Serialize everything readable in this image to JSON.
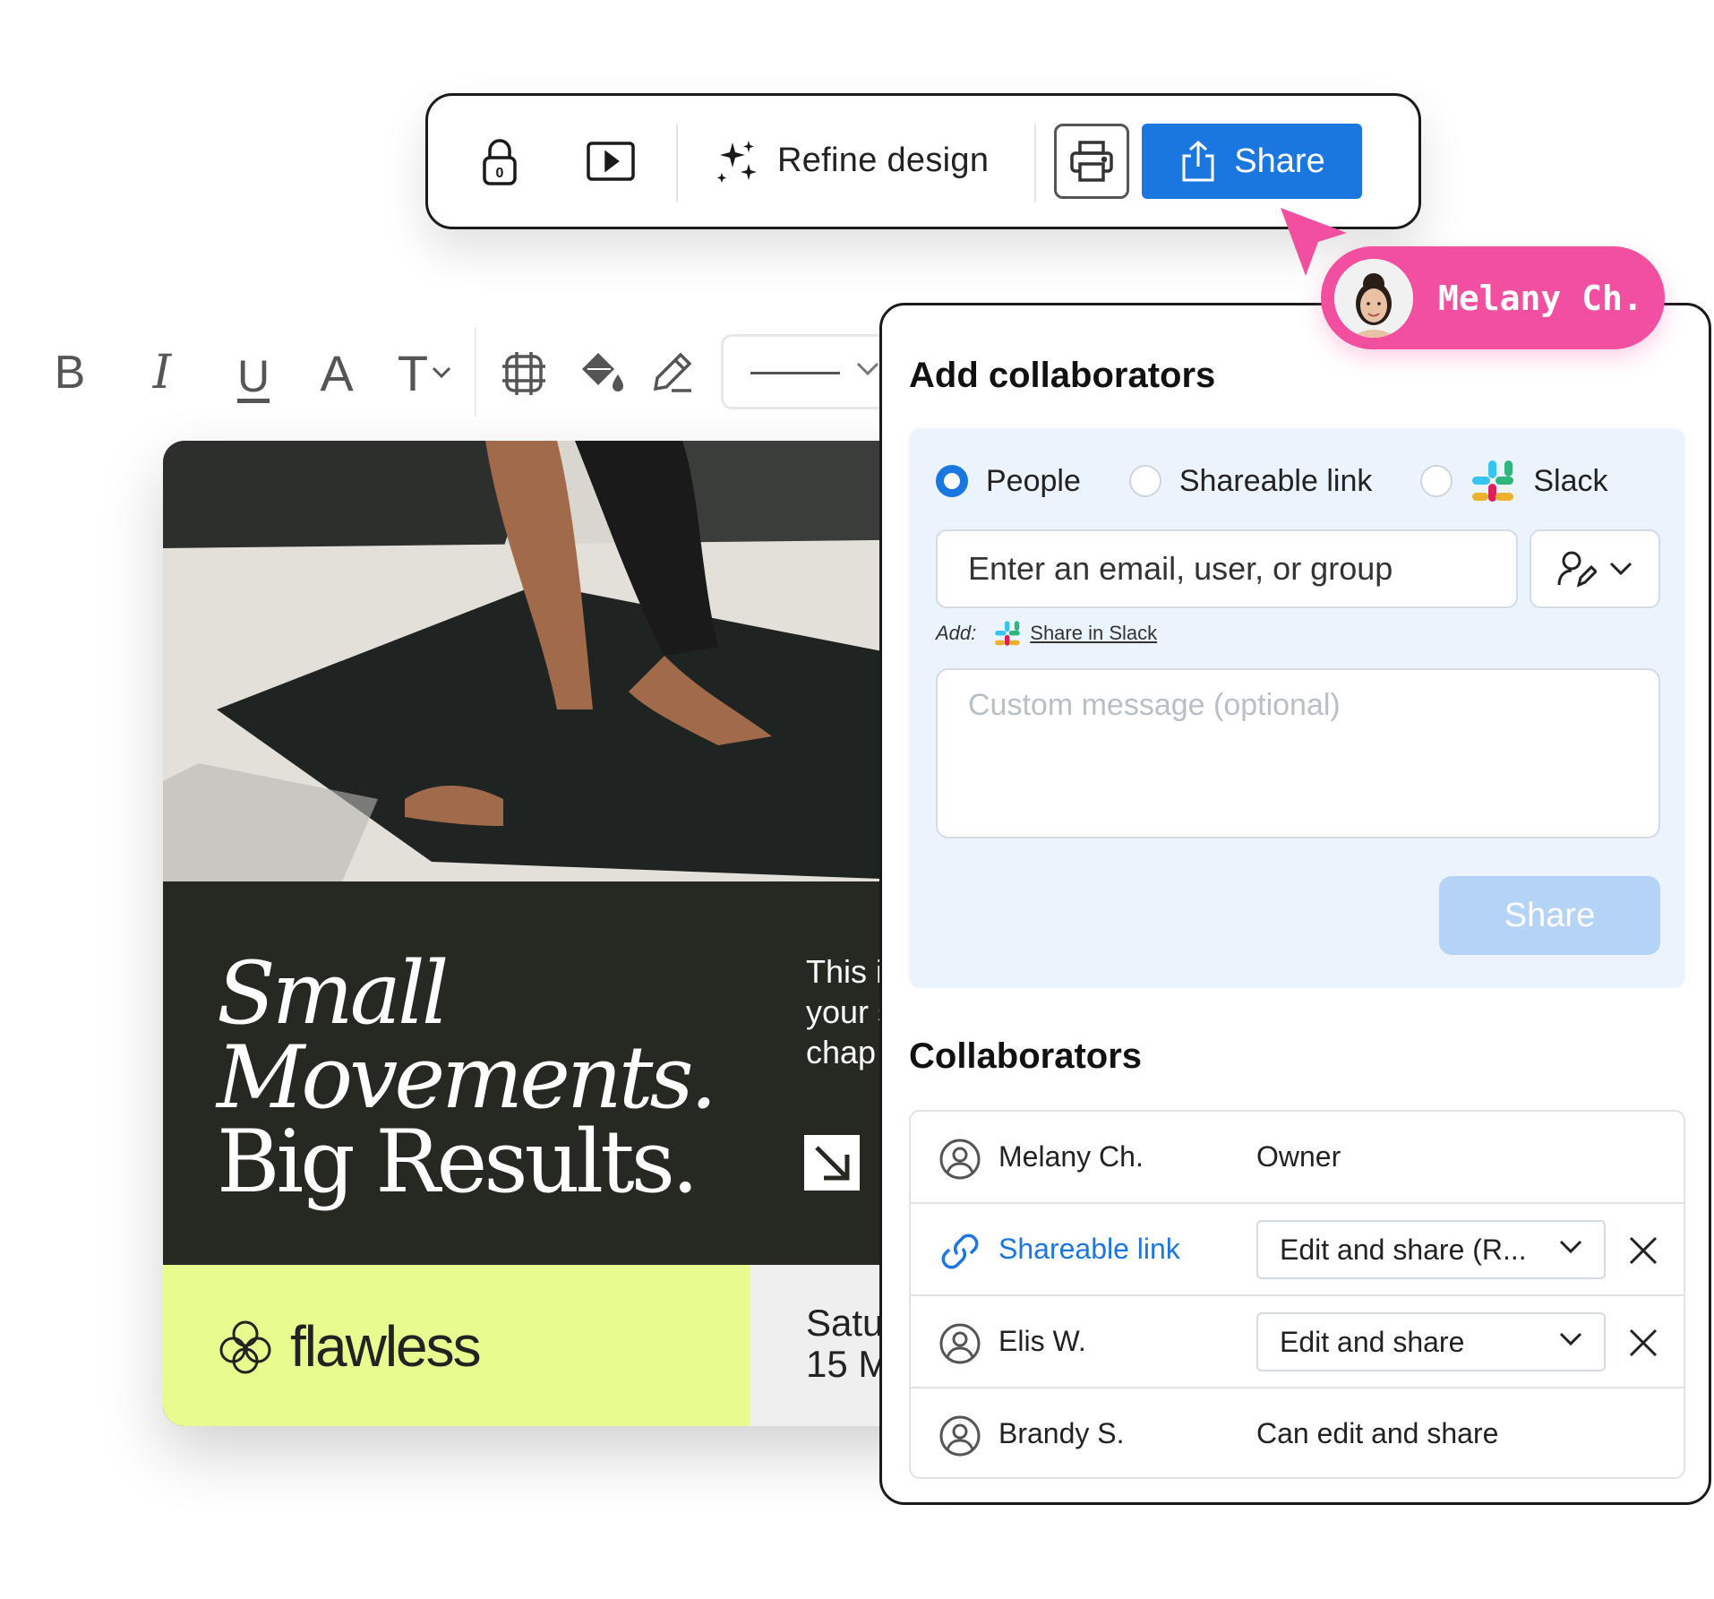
{
  "toolbar": {
    "refine_label": "Refine design",
    "share_label": "Share"
  },
  "cursor_tag": {
    "name": "Melany Ch.",
    "color": "#f24fa1"
  },
  "format_toolbar": {
    "bold": "B",
    "italic": "I",
    "underline": "U",
    "font_color": "A",
    "text_size": "T"
  },
  "design": {
    "headline_line1": "Small",
    "headline_line2": "Movements.",
    "headline_line3": "Big Results.",
    "side_copy_line1": "This is",
    "side_copy_line2": "your s",
    "side_copy_line3": "chap",
    "brand_name": "flawless",
    "date_line1": "Satu",
    "date_line2": "15 M",
    "brand_bar_color": "#e8fb8e",
    "panel_color": "#252922"
  },
  "share_panel": {
    "title": "Add collaborators",
    "radio_options": [
      {
        "label": "People",
        "selected": true
      },
      {
        "label": "Shareable link",
        "selected": false
      },
      {
        "label": "Slack",
        "selected": false
      }
    ],
    "email_placeholder": "Enter an email, user, or group",
    "add_label": "Add:",
    "share_in_slack": "Share in Slack",
    "message_placeholder": "Custom message (optional)",
    "share_button": "Share",
    "collaborators_title": "Collaborators",
    "collaborators": [
      {
        "name": "Melany Ch.",
        "role": "Owner",
        "icon": "user-circle-icon"
      },
      {
        "name": "Shareable link",
        "role": "Edit and share (R...",
        "icon": "link-icon"
      },
      {
        "name": "Elis W.",
        "role": "Edit and share",
        "icon": "user-circle-icon"
      },
      {
        "name": "Brandy S.",
        "role": "Can edit and share",
        "icon": "user-circle-icon"
      }
    ],
    "accent_color": "#1a77e0"
  }
}
